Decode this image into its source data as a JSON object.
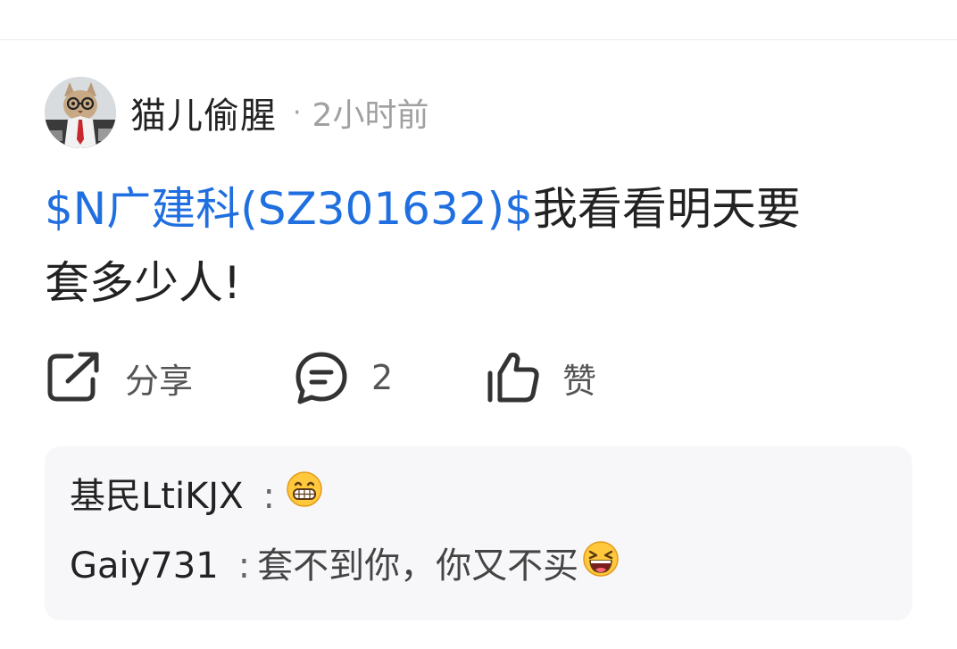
{
  "post": {
    "author": {
      "name": "猫儿偷腥",
      "avatar_icon": "cat-with-glasses-avatar-icon"
    },
    "separator": "·",
    "time": "2小时前",
    "stock_tag": "$N广建科(SZ301632)$",
    "text_line1": "我看看明天要",
    "text_line2": "套多少人!"
  },
  "actions": {
    "share_label": "分享",
    "comment_count": "2",
    "like_label": "赞"
  },
  "comments": [
    {
      "user": "基民LtiKJX",
      "colon": ":",
      "text": "",
      "emoji": "grinning-face-icon"
    },
    {
      "user": "Gaiy731",
      "colon": ":",
      "text": "套不到你，你又不买",
      "emoji": "laughing-face-icon"
    }
  ],
  "colors": {
    "link": "#1f6fe0",
    "muted": "#a0a0a0",
    "comment_bg": "#f7f7f9"
  }
}
